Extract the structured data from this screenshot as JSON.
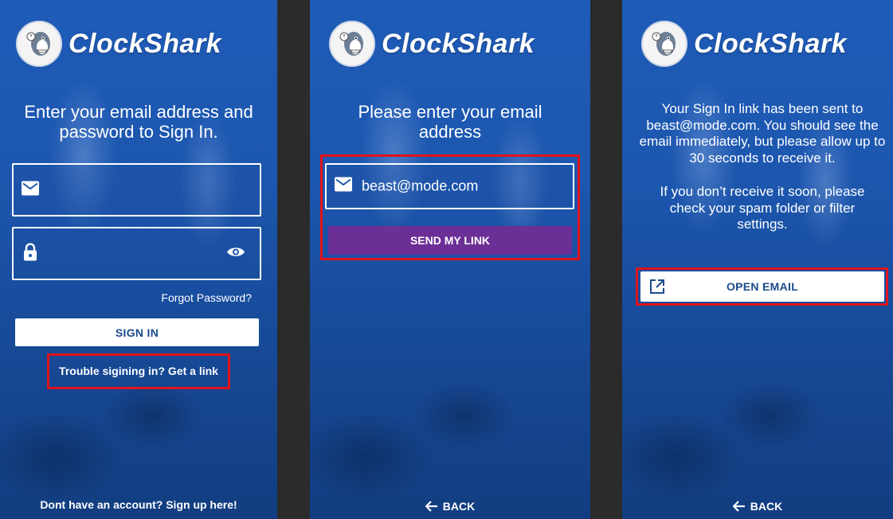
{
  "brand": {
    "name": "ClockShark"
  },
  "signin_screen": {
    "heading": "Enter your email address and password to Sign In.",
    "email_value": "",
    "password_value": "",
    "forgot_password": "Forgot Password?",
    "sign_in": "SIGN IN",
    "trouble_link": "Trouble sigining in? Get a link",
    "signup_link": "Dont have an account? Sign up here!"
  },
  "email_link_screen": {
    "heading": "Please enter your email address",
    "email_value": "beast@mode.com",
    "send_link": "SEND MY LINK",
    "back": "BACK"
  },
  "link_sent_screen": {
    "message_1": "Your Sign In link has been sent to beast@mode.com. You should see the email immediately, but please allow up to 30 seconds to receive it.",
    "message_2": "If you don’t receive it soon, please check your spam folder or filter settings.",
    "open_email": "OPEN EMAIL",
    "back": "BACK"
  },
  "colors": {
    "background_blue": "#1c56ae",
    "button_white": "#ffffff",
    "button_purple": "#6c2f96",
    "highlight_red": "#e0141c",
    "button_text_blue": "#1a4a8c"
  },
  "icons": [
    "shark-logo-icon",
    "mail-icon",
    "lock-icon",
    "eye-icon",
    "arrow-left-icon",
    "open-external-icon"
  ]
}
